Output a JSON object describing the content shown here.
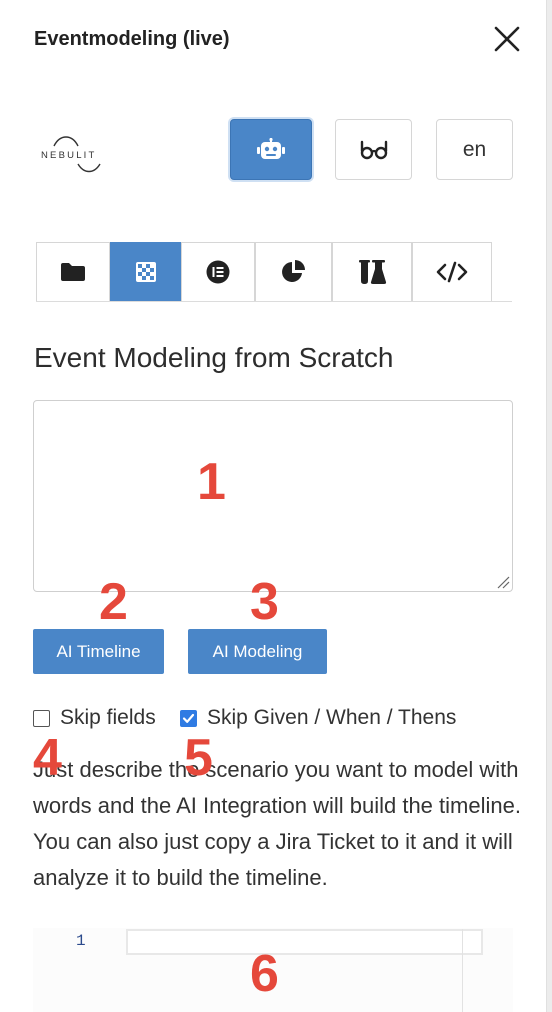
{
  "window": {
    "title": "Eventmodeling (live)"
  },
  "logo": {
    "text": "NEBULIT"
  },
  "toolbar": {
    "robot_icon": "robot-icon",
    "glasses_icon": "glasses-icon",
    "language_label": "en"
  },
  "tabs": [
    {
      "icon": "folder-icon",
      "active": false
    },
    {
      "icon": "checkerboard-icon",
      "active": true
    },
    {
      "icon": "list-circle-icon",
      "active": false
    },
    {
      "icon": "pie-chart-icon",
      "active": false
    },
    {
      "icon": "flask-icon",
      "active": false
    },
    {
      "icon": "code-icon",
      "active": false
    }
  ],
  "main": {
    "heading": "Event Modeling from Scratch",
    "prompt_value": "",
    "ai_timeline_label": "AI Timeline",
    "ai_modeling_label": "AI Modeling",
    "skip_fields_label": "Skip fields",
    "skip_fields_checked": false,
    "skip_gwt_label": "Skip Given / When / Thens",
    "skip_gwt_checked": true,
    "description": "Just describe the scenario you want to model with words and the AI Integration will build the timeline. You can also just copy a Jira Ticket to it and it will analyze it to build the timeline."
  },
  "editor": {
    "line_number": "1"
  },
  "annotations": {
    "n1": "1",
    "n2": "2",
    "n3": "3",
    "n4": "4",
    "n5": "5",
    "n6": "6"
  },
  "colors": {
    "accent": "#4a86c8",
    "annotation": "#e5483b",
    "checkbox_checked": "#2f7be3"
  }
}
